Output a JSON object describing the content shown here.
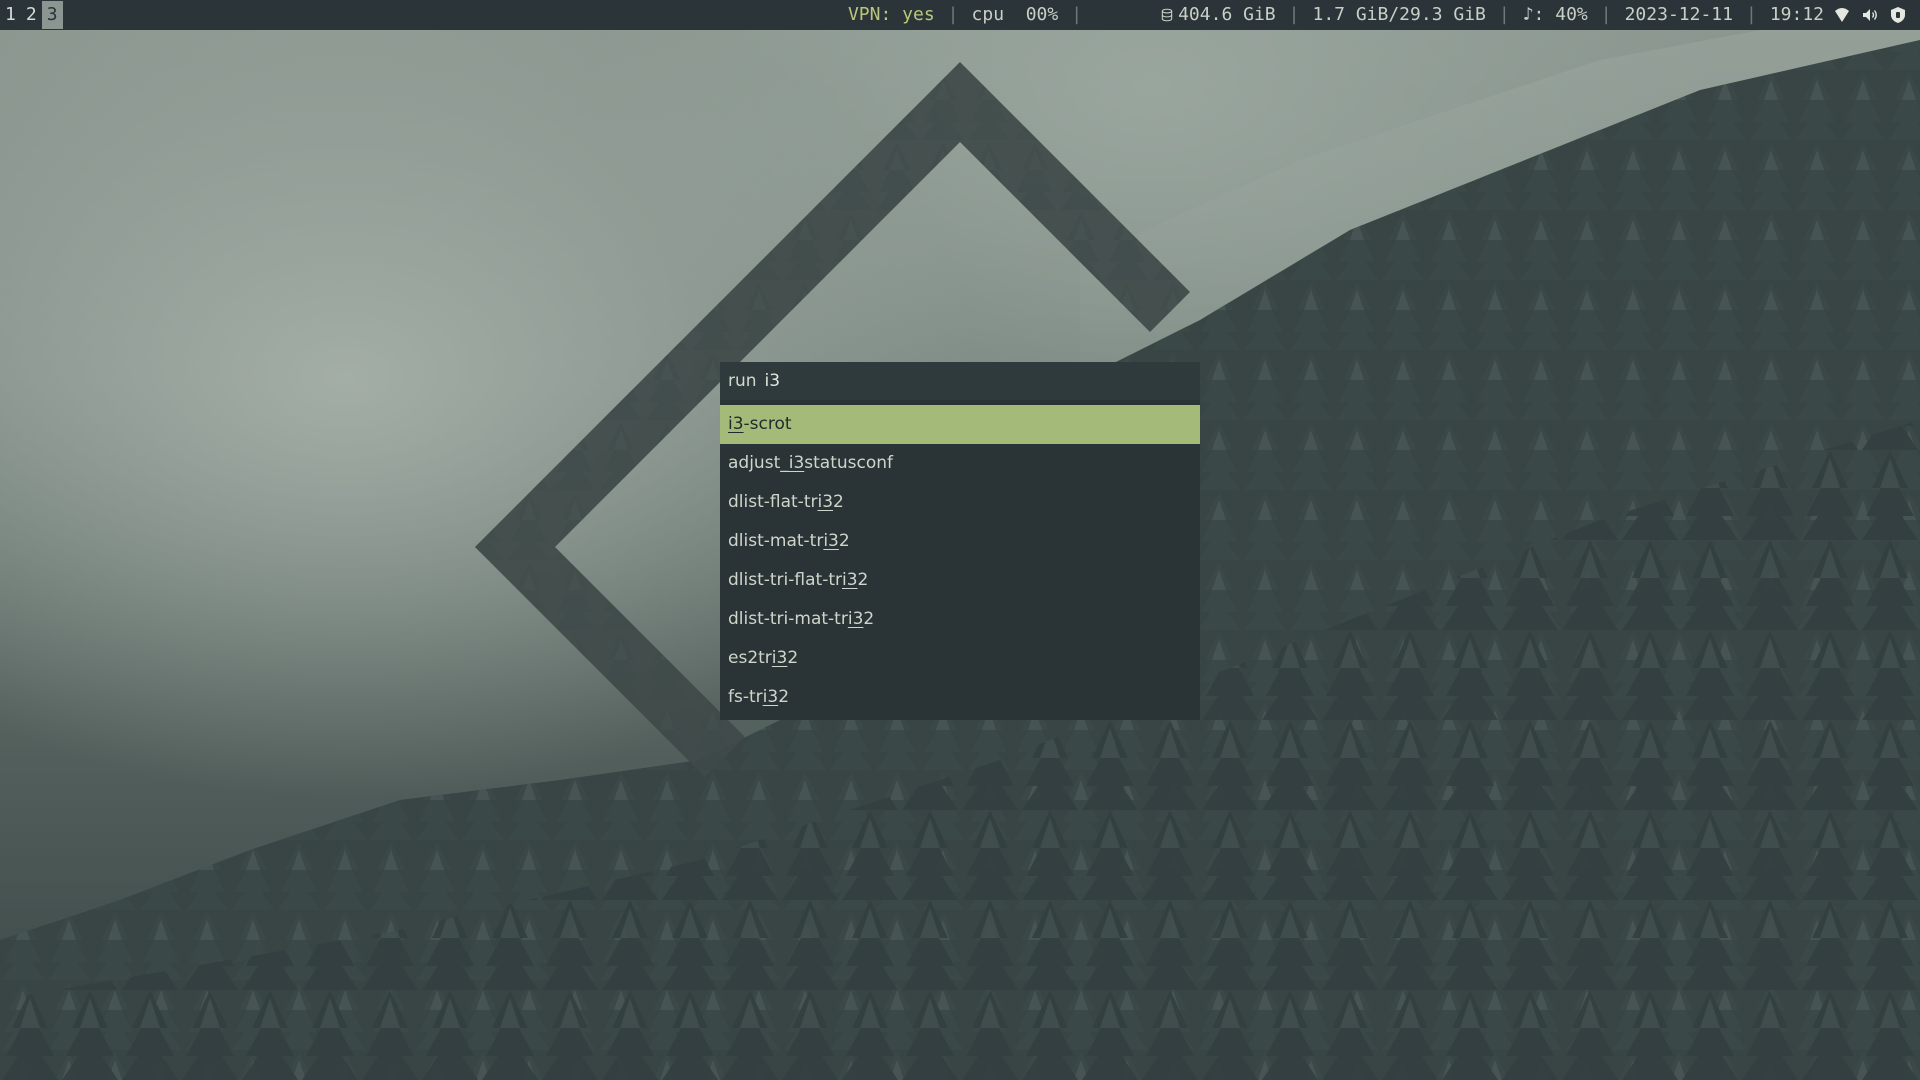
{
  "workspaces": [
    {
      "label": "1",
      "focused": false
    },
    {
      "label": "2",
      "focused": false
    },
    {
      "label": "3",
      "focused": true
    }
  ],
  "status": {
    "vpn": "VPN: yes",
    "cpu": "cpu  00%",
    "disk_icon": "database-icon",
    "disk": "404.6 GiB",
    "memory": "1.7 GiB/29.3 GiB",
    "volume": "♪: 40%",
    "date": "2023-12-11",
    "time": "19:12",
    "tray": [
      "wifi-icon",
      "speaker-icon",
      "shield-icon"
    ]
  },
  "launcher": {
    "prompt": "run",
    "query": "i3",
    "entries": [
      {
        "pre": "",
        "match": "i3",
        "post": "-scrot",
        "selected": true
      },
      {
        "pre": "adjust_",
        "match": "i3",
        "post": "statusconf",
        "selected": false
      },
      {
        "pre": "dlist-flat-tr",
        "match": "i3",
        "post": "2",
        "selected": false
      },
      {
        "pre": "dlist-mat-tr",
        "match": "i3",
        "post": "2",
        "selected": false
      },
      {
        "pre": "dlist-tri-flat-tr",
        "match": "i3",
        "post": "2",
        "selected": false
      },
      {
        "pre": "dlist-tri-mat-tr",
        "match": "i3",
        "post": "2",
        "selected": false
      },
      {
        "pre": "es2tr",
        "match": "i3",
        "post": "2",
        "selected": false
      },
      {
        "pre": "fs-tr",
        "match": "i3",
        "post": "2",
        "selected": false
      }
    ]
  },
  "colors": {
    "bar_bg": "#2b3438",
    "launcher_bg": "#2a3437",
    "selected_bg": "#a3ba79",
    "vpn_text": "#b9c77d"
  }
}
